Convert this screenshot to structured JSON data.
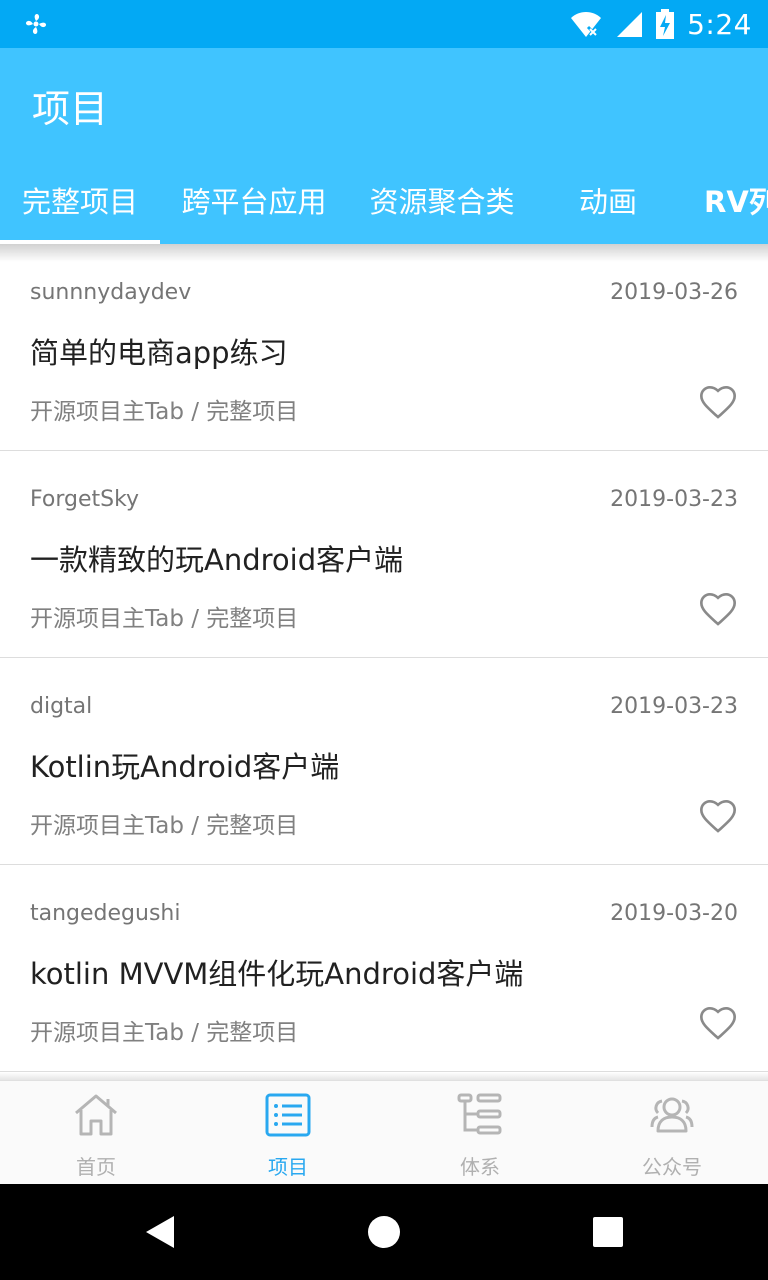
{
  "status_bar": {
    "time": "5:24",
    "left_icon": "fan-icon",
    "icons": [
      "wifi-icon",
      "signal-icon",
      "battery-charging-icon"
    ]
  },
  "app_bar": {
    "title": "项目",
    "tabs": [
      {
        "label": "完整项目",
        "selected": true
      },
      {
        "label": "跨平台应用",
        "selected": false
      },
      {
        "label": "资源聚合类",
        "selected": false
      },
      {
        "label": "动画",
        "selected": false
      },
      {
        "label": "RV列",
        "selected": false
      }
    ]
  },
  "projects": [
    {
      "author": "sunnnydaydev",
      "date": "2019-03-26",
      "title": "简单的电商app练习",
      "chapter": "开源项目主Tab / 完整项目"
    },
    {
      "author": "ForgetSky",
      "date": "2019-03-23",
      "title": "一款精致的玩Android客户端",
      "chapter": "开源项目主Tab / 完整项目"
    },
    {
      "author": "digtal",
      "date": "2019-03-23",
      "title": "Kotlin玩Android客户端",
      "chapter": "开源项目主Tab / 完整项目"
    },
    {
      "author": "tangedegushi",
      "date": "2019-03-20",
      "title": "kotlin MVVM组件化玩Android客户端",
      "chapter": "开源项目主Tab / 完整项目"
    }
  ],
  "bottom_nav": [
    {
      "label": "首页",
      "icon": "home-icon",
      "active": false
    },
    {
      "label": "项目",
      "icon": "list-icon",
      "active": true
    },
    {
      "label": "体系",
      "icon": "tree-icon",
      "active": false
    },
    {
      "label": "公众号",
      "icon": "people-icon",
      "active": false
    }
  ],
  "colors": {
    "status_bar": "#03a9f4",
    "app_bar": "#40c4ff",
    "accent": "#29a8f0",
    "inactive": "#b0b0b0"
  }
}
